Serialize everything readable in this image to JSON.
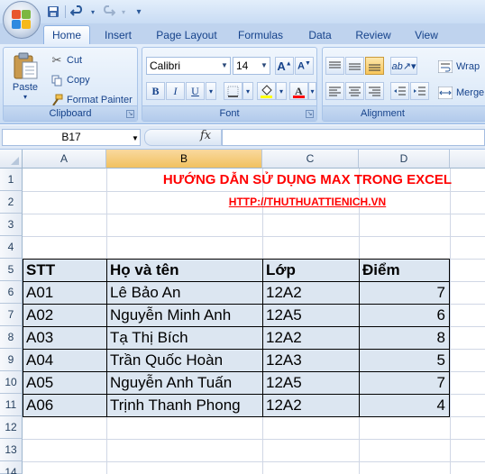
{
  "qat": {
    "save_icon": "save-icon",
    "undo_icon": "undo-icon",
    "redo_icon": "redo-icon"
  },
  "tabs": [
    "Home",
    "Insert",
    "Page Layout",
    "Formulas",
    "Data",
    "Review",
    "View"
  ],
  "clipboard": {
    "paste_label": "Paste",
    "cut_label": "Cut",
    "copy_label": "Copy",
    "format_painter_label": "Format Painter",
    "group_label": "Clipboard"
  },
  "font": {
    "family": "Calibri",
    "size": "14",
    "group_label": "Font",
    "bold": "B",
    "italic": "I",
    "underline": "U",
    "font_color": "#ff0000",
    "fill_color": "#ffff00"
  },
  "alignment": {
    "wrap_label": "Wrap",
    "merge_label": "Merge",
    "group_label": "Alignment"
  },
  "formula_bar": {
    "name_box": "B17",
    "fx_label": "fx",
    "formula": ""
  },
  "columns": [
    "A",
    "B",
    "C",
    "D"
  ],
  "rows": [
    "1",
    "2",
    "3",
    "4",
    "5",
    "6",
    "7",
    "8",
    "9",
    "10",
    "11",
    "12",
    "13",
    "14"
  ],
  "sheet": {
    "title": "HƯỚNG DẪN SỬ DỤNG MAX TRONG EXCEL",
    "link": "HTTP://THUTHUATTIENICH.VN",
    "headers": [
      "STT",
      "Họ và tên",
      "Lớp",
      "Điểm"
    ],
    "rows": [
      [
        "A01",
        "Lê Bảo An",
        "12A2",
        "7"
      ],
      [
        "A02",
        "Nguyễn Minh Anh",
        "12A5",
        "6"
      ],
      [
        "A03",
        "Tạ Thị Bích",
        "12A2",
        "8"
      ],
      [
        "A04",
        "Trần Quốc Hoàn",
        "12A3",
        "5"
      ],
      [
        "A05",
        "Nguyễn Anh Tuấn",
        "12A5",
        "7"
      ],
      [
        "A06",
        "Trịnh Thanh Phong",
        "12A2",
        "4"
      ]
    ]
  }
}
